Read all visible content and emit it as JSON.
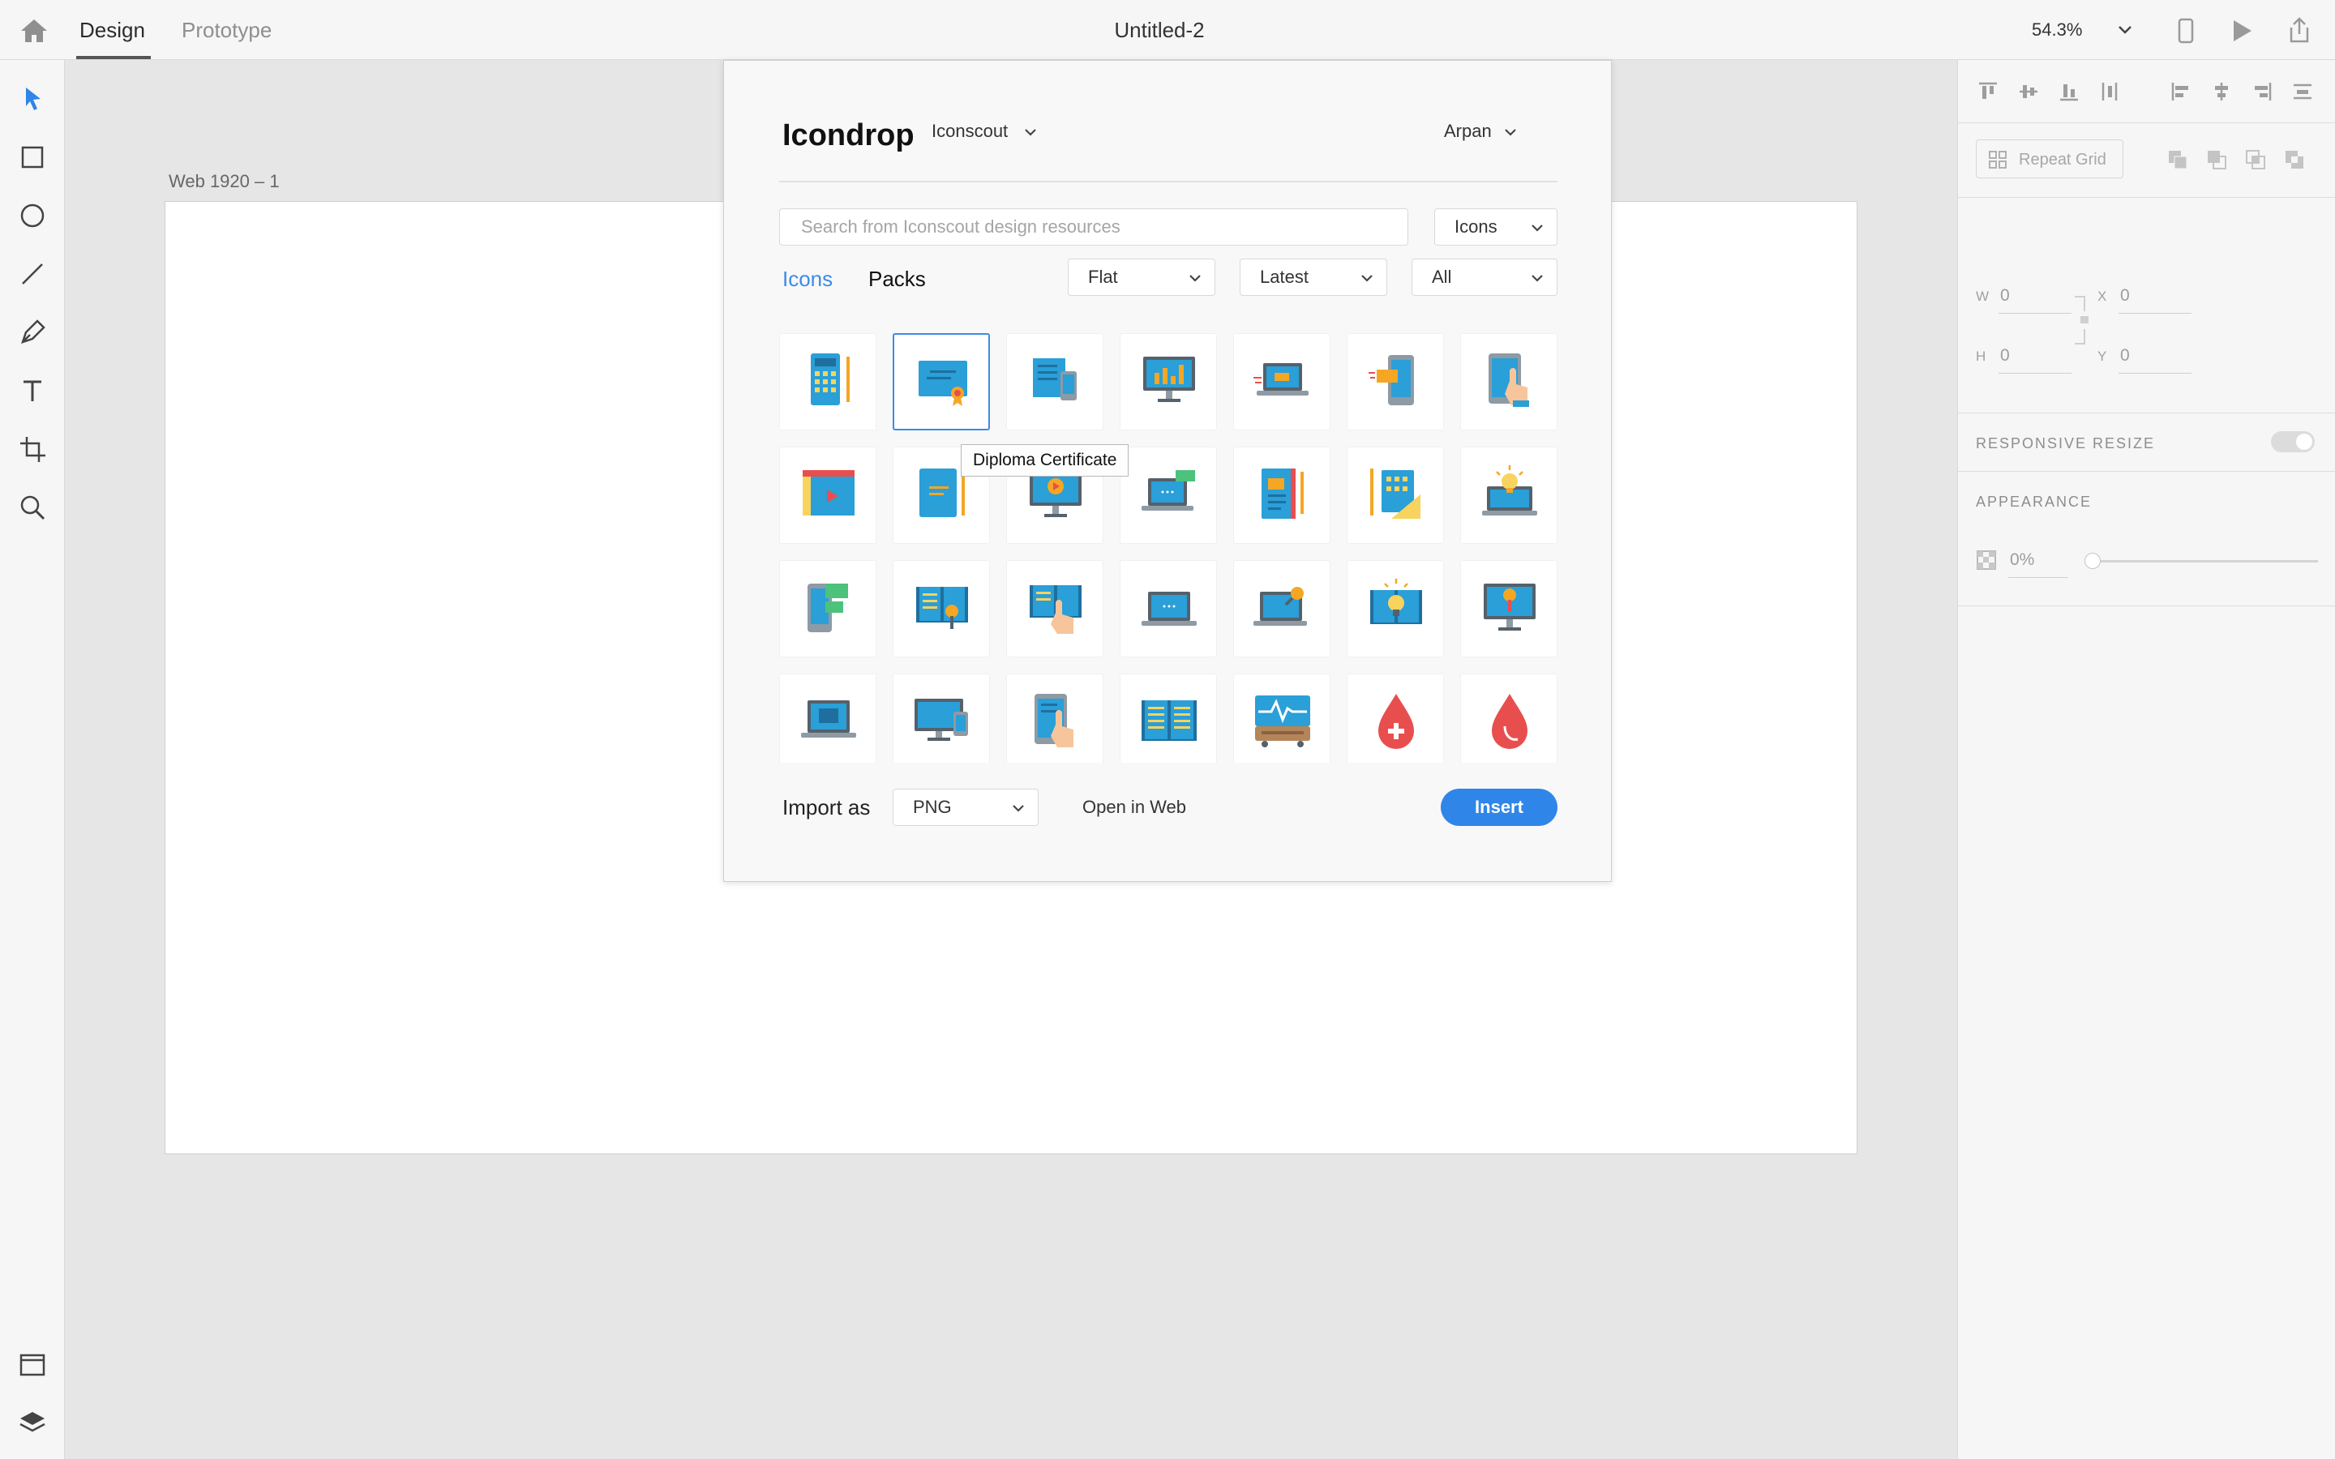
{
  "topbar": {
    "tabs": [
      "Design",
      "Prototype"
    ],
    "document_title": "Untitled-2",
    "zoom": "54.3%"
  },
  "canvas": {
    "artboard_label": "Web 1920 – 1"
  },
  "right_panel": {
    "repeat_grid_label": "Repeat Grid",
    "w_label": "W",
    "w_value": "0",
    "x_label": "X",
    "x_value": "0",
    "h_label": "H",
    "h_value": "0",
    "y_label": "Y",
    "y_value": "0",
    "responsive_resize_label": "RESPONSIVE RESIZE",
    "appearance_label": "APPEARANCE",
    "opacity_value": "0%",
    "opacity_slider_level": 0
  },
  "dialog": {
    "brand": "Icondrop",
    "source": "Iconscout",
    "user": "Arpan",
    "search_placeholder": "Search from Iconscout design resources",
    "type_select": "Icons",
    "tabs": [
      "Icons",
      "Packs"
    ],
    "active_tab": "Icons",
    "filters": [
      "Flat",
      "Latest",
      "All"
    ],
    "tooltip": "Diploma Certificate",
    "import_label": "Import as",
    "import_format": "PNG",
    "open_web_label": "Open in Web",
    "insert_label": "Insert",
    "accent_color": "#2f86e8",
    "icons": [
      "calculator-icon",
      "diploma-certificate-icon",
      "book-mobile-icon",
      "monitor-chart-icon",
      "laptop-video-icon",
      "mobile-message-icon",
      "tablet-touch-icon",
      "video-player-icon",
      "notebook-pencil-icon",
      "monitor-play-icon",
      "laptop-chat-icon",
      "notebook-icon",
      "calculator-ruler-icon",
      "laptop-idea-icon",
      "mobile-chat-icon",
      "book-search-icon",
      "book-touch-icon",
      "laptop-icon",
      "laptop-search-icon",
      "book-idea-icon",
      "monitor-pin-icon",
      "laptop-book-icon",
      "monitor-mobile-icon",
      "tablet-hand-icon",
      "open-book-icon",
      "heart-monitor-icon",
      "blood-drop-plus-icon",
      "blood-drop-icon"
    ]
  }
}
